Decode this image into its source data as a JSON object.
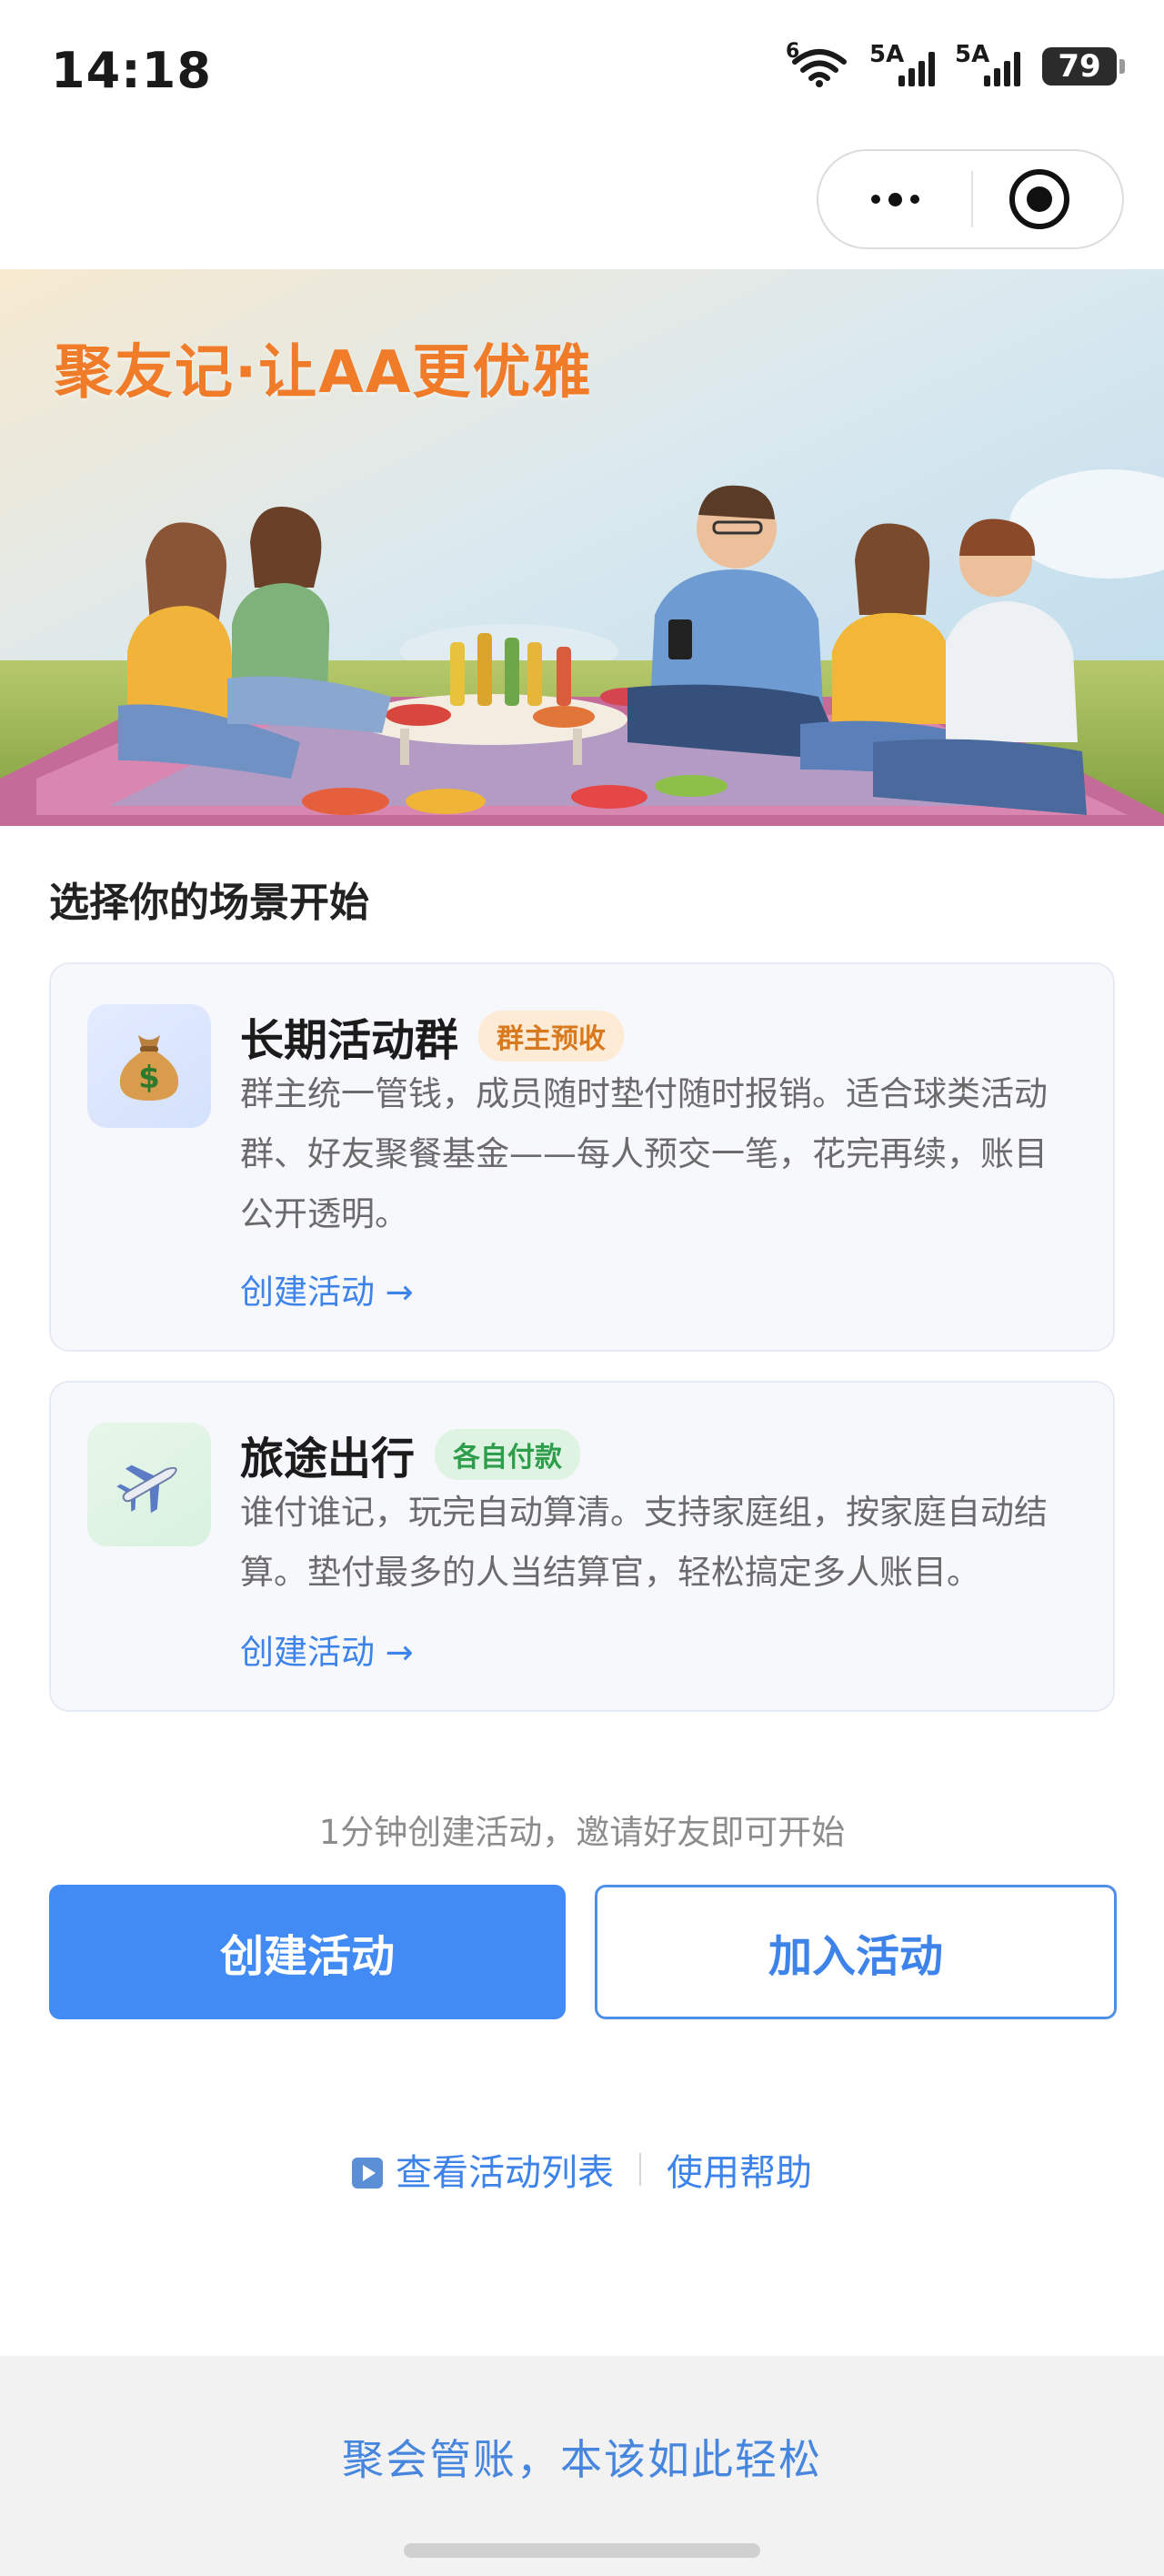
{
  "status_bar": {
    "time": "14:18",
    "wifi_badge": "6",
    "signal1_label": "5A",
    "signal2_label": "5A",
    "battery": "79"
  },
  "capsule": {
    "more_icon": "more-dots-icon",
    "close_icon": "target-close-icon"
  },
  "hero": {
    "title": "聚友记·让AA更优雅"
  },
  "section_title": "选择你的场景开始",
  "cards": [
    {
      "icon": "money-bag-icon",
      "title": "长期活动群",
      "tag": "群主预收",
      "description": "群主统一管钱，成员随时垫付随时报销。适合球类活动群、好友聚餐基金——每人预交一笔，花完再续，账目公开透明。",
      "link": "创建活动 →"
    },
    {
      "icon": "airplane-icon",
      "title": "旅途出行",
      "tag": "各自付款",
      "description": "谁付谁记，玩完自动算清。支持家庭组，按家庭自动结算。垫付最多的人当结算官，轻松搞定多人账目。",
      "link": "创建活动 →"
    }
  ],
  "hint": "1分钟创建活动，邀请好友即可开始",
  "buttons": {
    "create": "创建活动",
    "join": "加入活动"
  },
  "links": {
    "list": "查看活动列表",
    "help": "使用帮助"
  },
  "footer": {
    "slogan": "聚会管账，本该如此轻松"
  },
  "colors": {
    "primary": "#428bf4",
    "link": "#3d83ea",
    "hero_title": "#f07c2a"
  }
}
